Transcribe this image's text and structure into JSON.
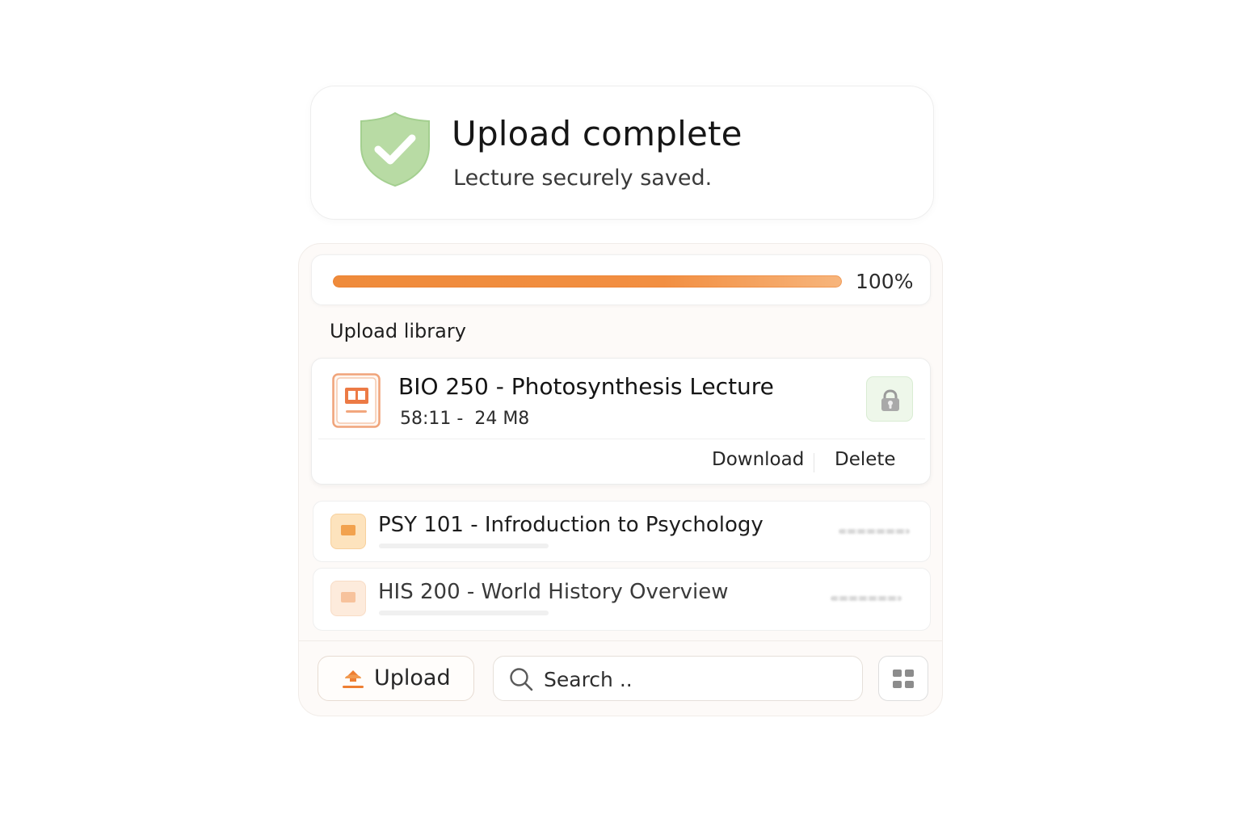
{
  "success": {
    "title": "Upload complete",
    "subtitle": "Lecture securely saved.",
    "icon": "shield-check-icon",
    "color": "#b8dba4"
  },
  "progress": {
    "value": 1.0,
    "label": "100%",
    "color": "#f28f42"
  },
  "library": {
    "label": "Upload library",
    "items": [
      {
        "title": "BIO 250 - Photosynthesis Lecture",
        "duration": "58:11",
        "size": "24 M8",
        "icon": "lecture-file-icon",
        "locked": true,
        "lock_icon": "lock-icon",
        "actions": {
          "download": "Download",
          "delete": "Delete"
        }
      },
      {
        "title": "PSY 101 - Infroduction to Psychology",
        "icon": "lecture-file-icon"
      },
      {
        "title": "HIS 200 - World History Overview",
        "icon": "lecture-file-icon"
      }
    ]
  },
  "toolbar": {
    "upload_label": "Upload",
    "upload_icon": "upload-icon",
    "search_placeholder": "Search ..",
    "search_icon": "search-icon",
    "grid_icon": "grid-view-icon"
  },
  "colors": {
    "accent": "#f28f42",
    "success": "#b8dba4"
  }
}
